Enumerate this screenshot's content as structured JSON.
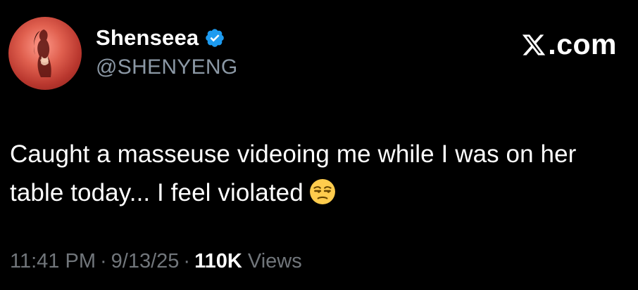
{
  "author": {
    "display_name": "Shenseea",
    "handle": "@SHENYENG",
    "verified": true,
    "avatar": "avatar-photo"
  },
  "brand": {
    "icon": "x-logo-icon",
    "text": ".com"
  },
  "tweet": {
    "text": "Caught a masseuse videoing me while I was on her table today... I feel violated",
    "emoji": "unamused-face-icon"
  },
  "meta": {
    "time": "11:41 PM",
    "separator": "·",
    "date": "9/13/25",
    "views_count": "110K",
    "views_label": "Views"
  },
  "colors": {
    "background": "#000000",
    "text_primary": "#ffffff",
    "text_secondary": "#71767b",
    "verified_blue": "#1d9bf0"
  }
}
